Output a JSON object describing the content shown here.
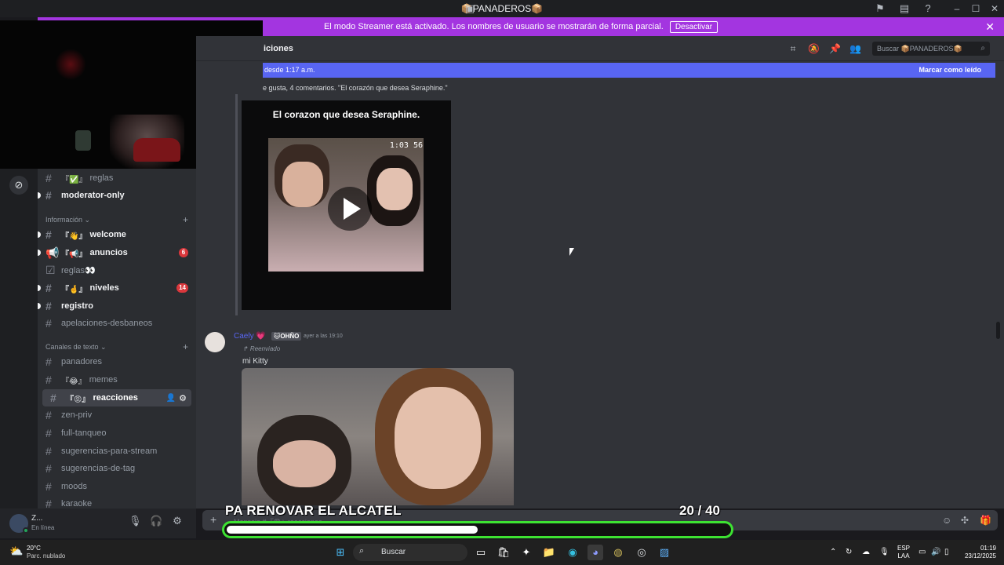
{
  "window": {
    "title": "📦PANADEROS📦"
  },
  "streamer_bar": {
    "message": "El modo Streamer está activado. Los nombres de usuario se mostrarán de forma parcial.",
    "deactivate": "Desactivar"
  },
  "channel_header": {
    "name": "iciones",
    "search_placeholder": "Buscar 📦PANADEROS📦"
  },
  "new_messages_bar": {
    "since": "desde 1:17 a.m.",
    "mark_read": "Marcar como leído"
  },
  "sidebar": {
    "categories": [
      {
        "label": "Información ⌄"
      },
      {
        "label": "Canales de texto ⌄"
      }
    ],
    "channels": [
      {
        "label": "reglas",
        "emoji": "『✅』"
      },
      {
        "label": "moderator-only",
        "emoji": ""
      },
      {
        "label": "welcome",
        "emoji": "『👋』"
      },
      {
        "label": "anuncios",
        "emoji": "『📢』",
        "badge": "6"
      },
      {
        "label": "reglas👀",
        "emoji": ""
      },
      {
        "label": "niveles",
        "emoji": "『🤞』",
        "badge": "14"
      },
      {
        "label": "registro",
        "emoji": ""
      },
      {
        "label": "apelaciones-desbaneos",
        "emoji": ""
      },
      {
        "label": "panadores",
        "emoji": ""
      },
      {
        "label": "memes",
        "emoji": "『😂』"
      },
      {
        "label": "reacciones",
        "emoji": "『😡』"
      },
      {
        "label": "zen-priv",
        "emoji": ""
      },
      {
        "label": "full-tanqueo",
        "emoji": ""
      },
      {
        "label": "sugerencias-para-stream",
        "emoji": ""
      },
      {
        "label": "sugerencias-de-tag",
        "emoji": ""
      },
      {
        "label": "moods",
        "emoji": ""
      },
      {
        "label": "karaoke",
        "emoji": ""
      }
    ]
  },
  "user": {
    "name": "Z...",
    "status": "En línea"
  },
  "messages": {
    "first_summary": "e gusta, 4 comentarios. \"El corazón que desea Seraphine.\"",
    "video_title": "El corazon que desea Seraphine.",
    "video_timer": "1:03 56",
    "second": {
      "author": "Caely 💗",
      "tag": "🐱OHÑO",
      "time": "ayer a las 19:10",
      "forwarded": "↱ Reenviado",
      "body": "mi Kitty"
    }
  },
  "composer": {
    "placeholder": "Mensaje #『😡』reacciones"
  },
  "stream_overlay": {
    "goal_text": "PA RENOVAR EL ALCATEL",
    "current": "20",
    "target": "/ 40",
    "progress_fraction": 0.5
  },
  "taskbar": {
    "weather_temp": "20°C",
    "weather_cond": "Parc. nublado",
    "search": "Buscar",
    "lang1": "ESP",
    "lang2": "LAA",
    "time": "01:19",
    "date": "23/12/2025"
  },
  "colors": {
    "streamer_purple": "#a335e0",
    "blurple": "#5865f2",
    "progress_green": "#3de232",
    "badge_red": "#da373c"
  }
}
